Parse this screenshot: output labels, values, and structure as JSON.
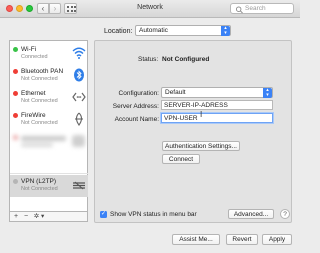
{
  "window": {
    "title": "Network",
    "search_placeholder": "Search"
  },
  "location": {
    "label": "Location:",
    "value": "Automatic"
  },
  "services": [
    {
      "name": "Wi-Fi",
      "status": "Connected",
      "status_color": "#38c247",
      "icon": "wifi-icon"
    },
    {
      "name": "Bluetooth PAN",
      "status": "Not Connected",
      "status_color": "#ef3e36",
      "icon": "bluetooth-icon"
    },
    {
      "name": "Ethernet",
      "status": "Not Connected",
      "status_color": "#ef3e36",
      "icon": "ethernet-icon"
    },
    {
      "name": "FireWire",
      "status": "Not Connected",
      "status_color": "#ef3e36",
      "icon": "firewire-icon"
    },
    {
      "name": "VPN (L2TP)",
      "status": "Not Connected",
      "status_color": "#b5b5b5",
      "icon": "vpn-icon"
    }
  ],
  "sidebar_controls": {
    "add": "+",
    "remove": "−",
    "action": "✲ ▾"
  },
  "detail": {
    "status_label": "Status:",
    "status_value": "Not Configured",
    "configuration_label": "Configuration:",
    "configuration_value": "Default",
    "server_label": "Server Address:",
    "server_value": "SERVER-IP-ADRESS",
    "account_label": "Account Name:",
    "account_value": "VPN-USER",
    "auth_button": "Authentication Settings...",
    "connect_button": "Connect",
    "show_vpn_label": "Show VPN status in menu bar",
    "advanced_button": "Advanced...",
    "help_button": "?"
  },
  "footer": {
    "assist": "Assist Me...",
    "revert": "Revert",
    "apply": "Apply"
  },
  "colors": {
    "accent": "#3b82f6",
    "connected": "#38c247",
    "disconnected": "#ef3e36"
  }
}
